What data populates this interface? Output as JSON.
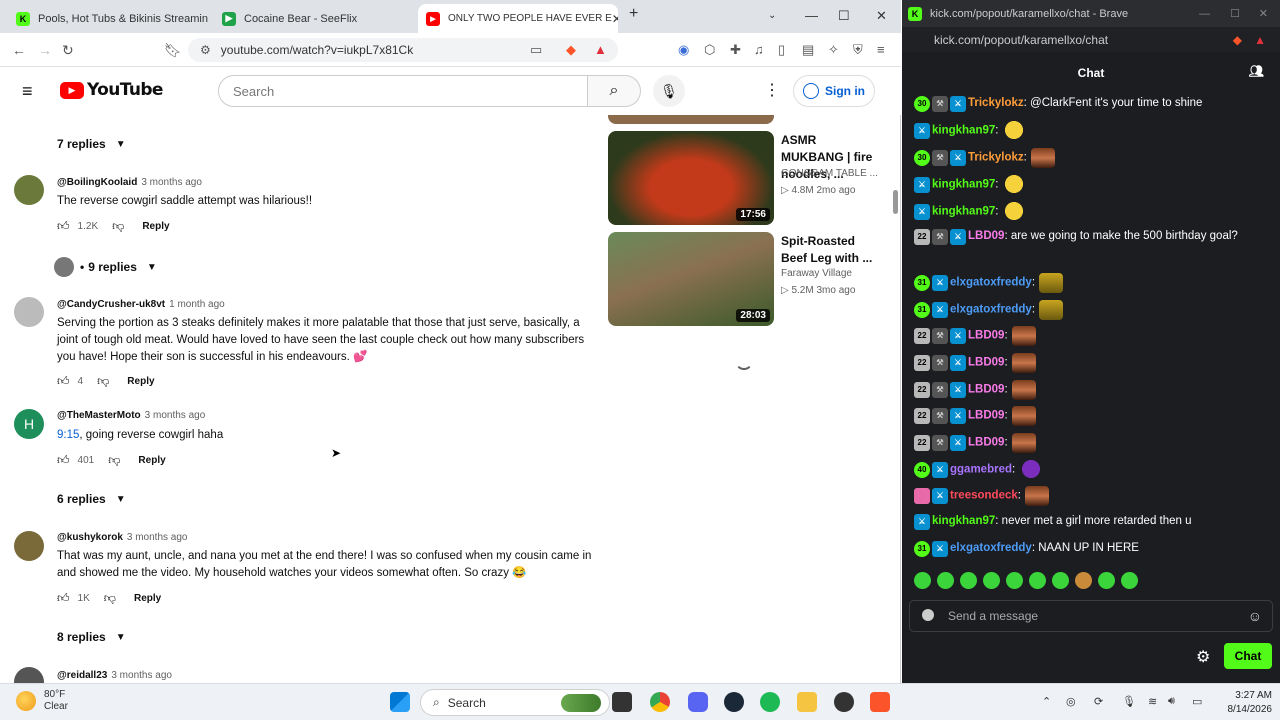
{
  "left_browser": {
    "tabs": [
      {
        "title": "Pools, Hot Tubs & Bikinis Streaming",
        "favicon_color": "#53fc18",
        "favicon_text": "K"
      },
      {
        "title": "Cocaine Bear - SeeFlix",
        "favicon_color": "#1fa34a",
        "favicon_text": "▶"
      },
      {
        "title": "ONLY TWO PEOPLE HAVE EVER E",
        "favicon_color": "#ff0000",
        "favicon_text": "▶"
      }
    ],
    "new_tab_label": "+",
    "url": "youtube.com/watch?v=iukpL7x81Ck"
  },
  "youtube": {
    "logo_text": "YouTube",
    "search_placeholder": "Search",
    "signin_label": "Sign in",
    "replies_toggles": [
      "7 replies",
      "9 replies",
      "6 replies",
      "8 replies"
    ],
    "comments": [
      {
        "author": "@BoilingKoolaid",
        "time": "3 months ago",
        "text": "The reverse cowgirl saddle attempt was hilarious!!",
        "likes": "1.2K",
        "reply_label": "Reply",
        "avatar_color": "#6b7a3a",
        "avatar_text": ""
      },
      {
        "author": "@CandyCrusher-uk8vt",
        "time": "1 month ago",
        "text": "Serving the portion as 3 steaks definitely makes it more palatable that those that just serve, basically, a joint of tough old meat. Would have loved to have seen the last couple check out how many subscribers you have! Hope their son  is successful in his endeavours. 💕",
        "likes": "4",
        "reply_label": "Reply",
        "avatar_color": "#bbbbbb",
        "avatar_text": ""
      },
      {
        "author": "@TheMasterMoto",
        "time": "3 months ago",
        "text_link": "9:15",
        "text": ", going reverse cowgirl haha",
        "likes": "401",
        "reply_label": "Reply",
        "avatar_color": "#1e8e5a",
        "avatar_text": "H"
      },
      {
        "author": "@kushykorok",
        "time": "3 months ago",
        "text": "That was my aunt, uncle, and nana you met at the end there! I was so confused when my cousin came in and showed me the video. My household watches your videos somewhat often. So crazy 😂",
        "likes": "1K",
        "reply_label": "Reply",
        "avatar_color": "#7a6a3a",
        "avatar_text": ""
      },
      {
        "author": "@reidall23",
        "time": "3 months ago"
      }
    ],
    "related": [
      {
        "title": "ASMR MUKBANG | fire noodles, ...",
        "channel": "GONGSAM TABLE ...",
        "meta": "▷ 4.8M  2mo ago",
        "duration": "17:56",
        "thumb_a": "#c23a1a",
        "thumb_b": "#2e3a1c"
      },
      {
        "title": "Spit-Roasted Beef Leg with ...",
        "channel": "Faraway Village",
        "meta": "▷ 5.2M  3mo ago",
        "duration": "28:03",
        "thumb_a": "#8a7050",
        "thumb_b": "#3b5a2a"
      }
    ]
  },
  "right_browser": {
    "window_title": "kick.com/popout/karamellxo/chat - Brave",
    "url": "kick.com/popout/karamellxo/chat",
    "chat_header": "Chat",
    "messages": [
      {
        "badges": [
          "30",
          "mod",
          "vip"
        ],
        "user": "Trickylokz",
        "color": "#ff9d3a",
        "text": ": @ClarkFent it's your time to shine",
        "emote": ""
      },
      {
        "badges": [
          "vip"
        ],
        "user": "kingkhan97",
        "color": "#53fc18",
        "text": ":",
        "emote": "e-duck"
      },
      {
        "badges": [
          "30",
          "mod",
          "vip"
        ],
        "user": "Trickylokz",
        "color": "#ff9d3a",
        "text": ":",
        "emote": "e-face"
      },
      {
        "badges": [
          "vip"
        ],
        "user": "kingkhan97",
        "color": "#53fc18",
        "text": ":",
        "emote": "e-duck"
      },
      {
        "badges": [
          "vip"
        ],
        "user": "kingkhan97",
        "color": "#53fc18",
        "text": ":",
        "emote": "e-duck"
      },
      {
        "badges": [
          "22",
          "mod",
          "vip"
        ],
        "user": "LBD09",
        "color": "#f97ce8",
        "text": ": are we going to make the 500 birthday goal?",
        "emote": ""
      },
      {
        "badges": [
          "31",
          "vip"
        ],
        "user": "elxgatoxfreddy",
        "color": "#4d9cf7",
        "text": ":",
        "emote": "e-gator"
      },
      {
        "badges": [
          "31",
          "vip"
        ],
        "user": "elxgatoxfreddy",
        "color": "#4d9cf7",
        "text": ":",
        "emote": "e-gator"
      },
      {
        "badges": [
          "22",
          "mod",
          "vip"
        ],
        "user": "LBD09",
        "color": "#f97ce8",
        "text": ":",
        "emote": "e-face"
      },
      {
        "badges": [
          "22",
          "mod",
          "vip"
        ],
        "user": "LBD09",
        "color": "#f97ce8",
        "text": ":",
        "emote": "e-face"
      },
      {
        "badges": [
          "22",
          "mod",
          "vip"
        ],
        "user": "LBD09",
        "color": "#f97ce8",
        "text": ":",
        "emote": "e-face"
      },
      {
        "badges": [
          "22",
          "mod",
          "vip"
        ],
        "user": "LBD09",
        "color": "#f97ce8",
        "text": ":",
        "emote": "e-face"
      },
      {
        "badges": [
          "22",
          "mod",
          "vip"
        ],
        "user": "LBD09",
        "color": "#f97ce8",
        "text": ":",
        "emote": "e-face"
      },
      {
        "badges": [
          "40",
          "vip"
        ],
        "user": "ggamebred",
        "color": "#a874ff",
        "text": ":",
        "emote": "e-purple"
      },
      {
        "badges": [
          "pink",
          "vip"
        ],
        "user": "treesondeck",
        "color": "#ff4a5a",
        "text": ":",
        "emote": "e-face"
      },
      {
        "badges": [
          "vip"
        ],
        "user": "kingkhan97",
        "color": "#53fc18",
        "text": ": never met a girl more retarded then u",
        "emote": ""
      },
      {
        "badges": [
          "31",
          "vip"
        ],
        "user": "elxgatoxfreddy",
        "color": "#4d9cf7",
        "text": ": NAAN UP IN HERE",
        "emote": ""
      }
    ],
    "input_placeholder": "Send a message",
    "chat_button": "Chat"
  },
  "taskbar": {
    "weather_temp": "80°F",
    "weather_cond": "Clear",
    "search_label": "Search",
    "time": "3:27 AM",
    "date": "8/14/2026"
  }
}
